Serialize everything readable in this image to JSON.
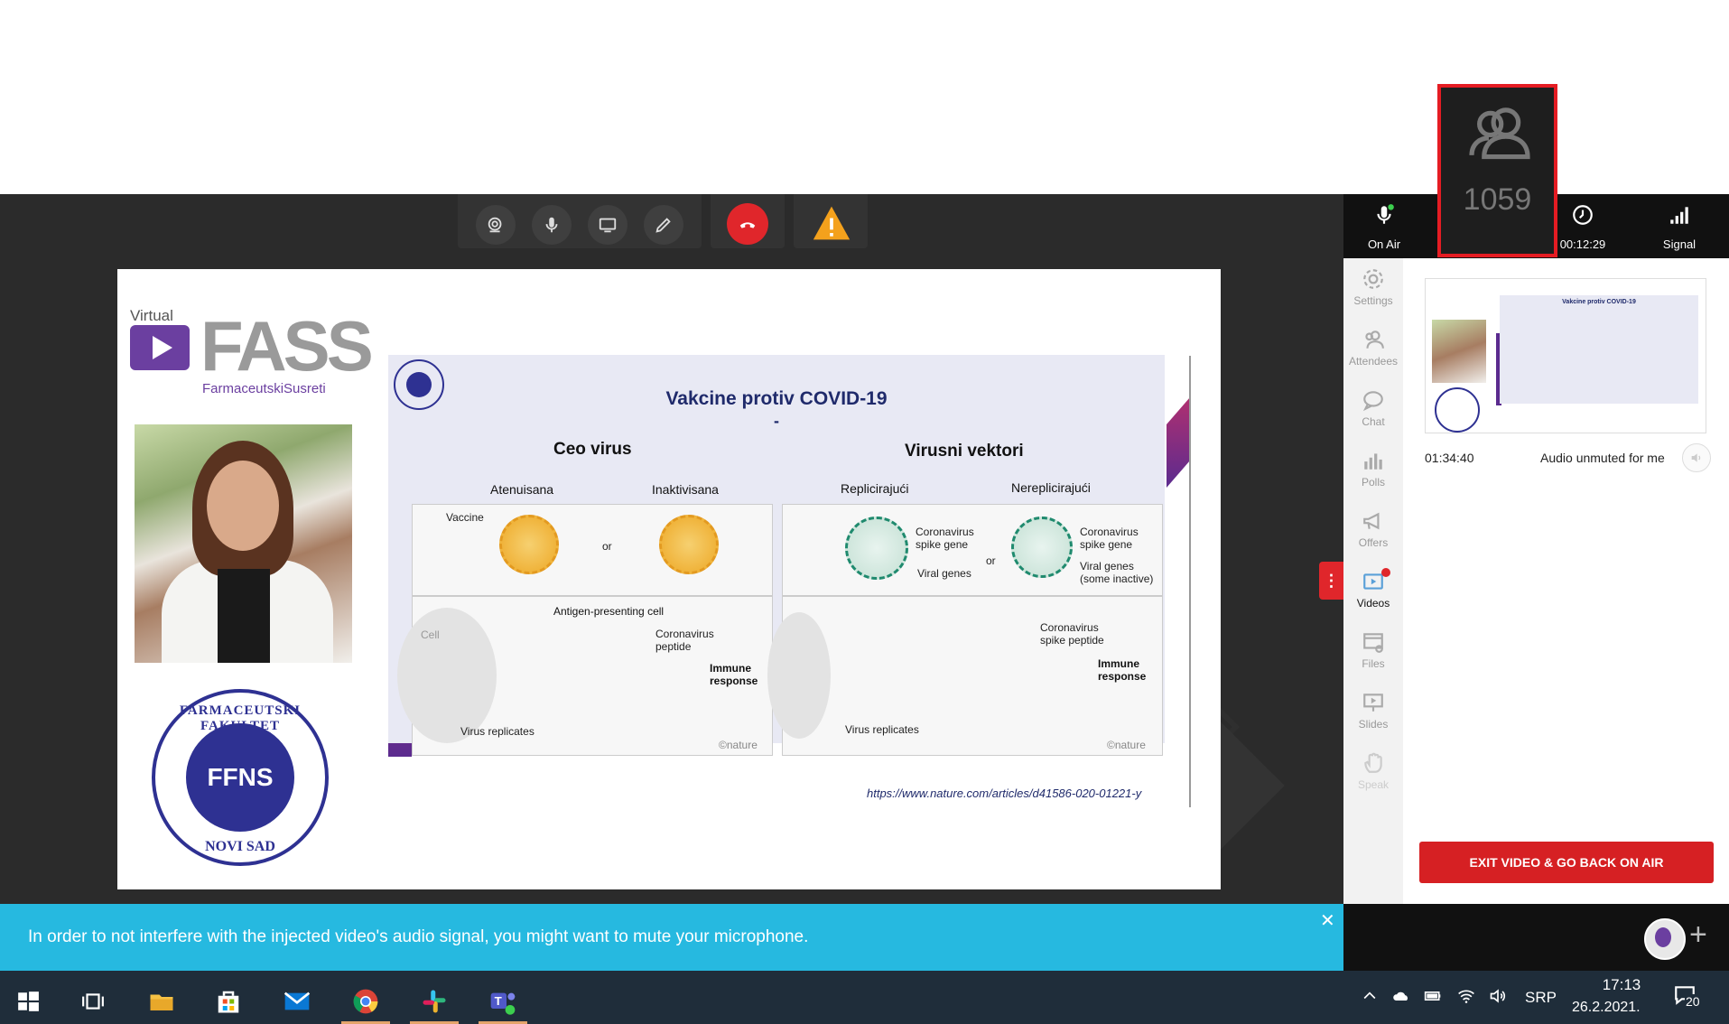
{
  "toolbar": {
    "buttons": [
      "camera-search-icon",
      "microphone-icon",
      "screen-share-icon",
      "pen-icon"
    ],
    "hangup_icon": "phone-hangup-icon",
    "warning_icon": "warning-icon"
  },
  "slide": {
    "logo_virtual": "Virtual",
    "logo_fass": "FASS",
    "logo_subtitle": "FarmaceutskiSusreti",
    "seal_center": "FFNS",
    "seal_top": "FARMACEUTSKI FAKULTET",
    "seal_bottom": "NOVI SAD",
    "title": "Vakcine protiv COVID-19",
    "title_dash": "-",
    "col1_header": "Ceo virus",
    "col2_header": "Virusni vektori",
    "sub_atenuisana": "Atenuisana",
    "sub_inaktivisana": "Inaktivisana",
    "sub_replicirajuci": "Replicirajući",
    "sub_nereplicirajuci": "Nereplicirajući",
    "left_labels": {
      "vaccine": "Vaccine",
      "or": "or",
      "apc": "Antigen-presenting cell",
      "cell": "Cell",
      "cov_peptide": "Coronavirus peptide",
      "immune": "Immune response",
      "virus_replicates": "Virus replicates",
      "nature": "©nature"
    },
    "right_labels": {
      "spike1": "Coronavirus spike gene",
      "viral_genes": "Viral genes",
      "or": "or",
      "spike2": "Coronavirus spike gene",
      "viral_genes_inactive": "Viral genes (some inactive)",
      "spike_peptide": "Coronavirus spike peptide",
      "immune": "Immune response",
      "virus_replicates": "Virus replicates",
      "nature": "©nature"
    },
    "url": "https://www.nature.com/articles/d41586-020-01221-y"
  },
  "side_handle_label": "⋮",
  "header": {
    "on_air": "On Air",
    "attendees_count": "1059",
    "timer": "00:12:29",
    "signal": "Signal"
  },
  "sidebar": {
    "items": [
      {
        "label": "Settings",
        "icon": "gear-icon"
      },
      {
        "label": "Attendees",
        "icon": "attendees-icon"
      },
      {
        "label": "Chat",
        "icon": "chat-icon"
      },
      {
        "label": "Polls",
        "icon": "polls-icon"
      },
      {
        "label": "Offers",
        "icon": "megaphone-icon"
      },
      {
        "label": "Videos",
        "icon": "video-icon"
      },
      {
        "label": "Files",
        "icon": "files-icon"
      },
      {
        "label": "Slides",
        "icon": "slides-icon"
      },
      {
        "label": "Speak",
        "icon": "hand-icon"
      }
    ]
  },
  "videos_panel": {
    "time": "01:34:40",
    "status": "Audio unmuted for me",
    "exit_button": "EXIT VIDEO & GO BACK ON AIR",
    "thumb_title": "Vakcine protiv COVID-19"
  },
  "notification": {
    "message": "In order to not interfere with the injected video's audio signal, you might want to mute your microphone.",
    "close": "✕"
  },
  "footer": {
    "plus": "+"
  },
  "taskbar": {
    "tray_lang": "SRP",
    "clock_time": "17:13",
    "clock_date": "26.2.2021.",
    "notifications_count": "20"
  },
  "colors": {
    "accent_red": "#e0262b",
    "notification_blue": "#26b9e0",
    "brand_purple": "#6b3fa0",
    "ffns_blue": "#2e3192"
  }
}
